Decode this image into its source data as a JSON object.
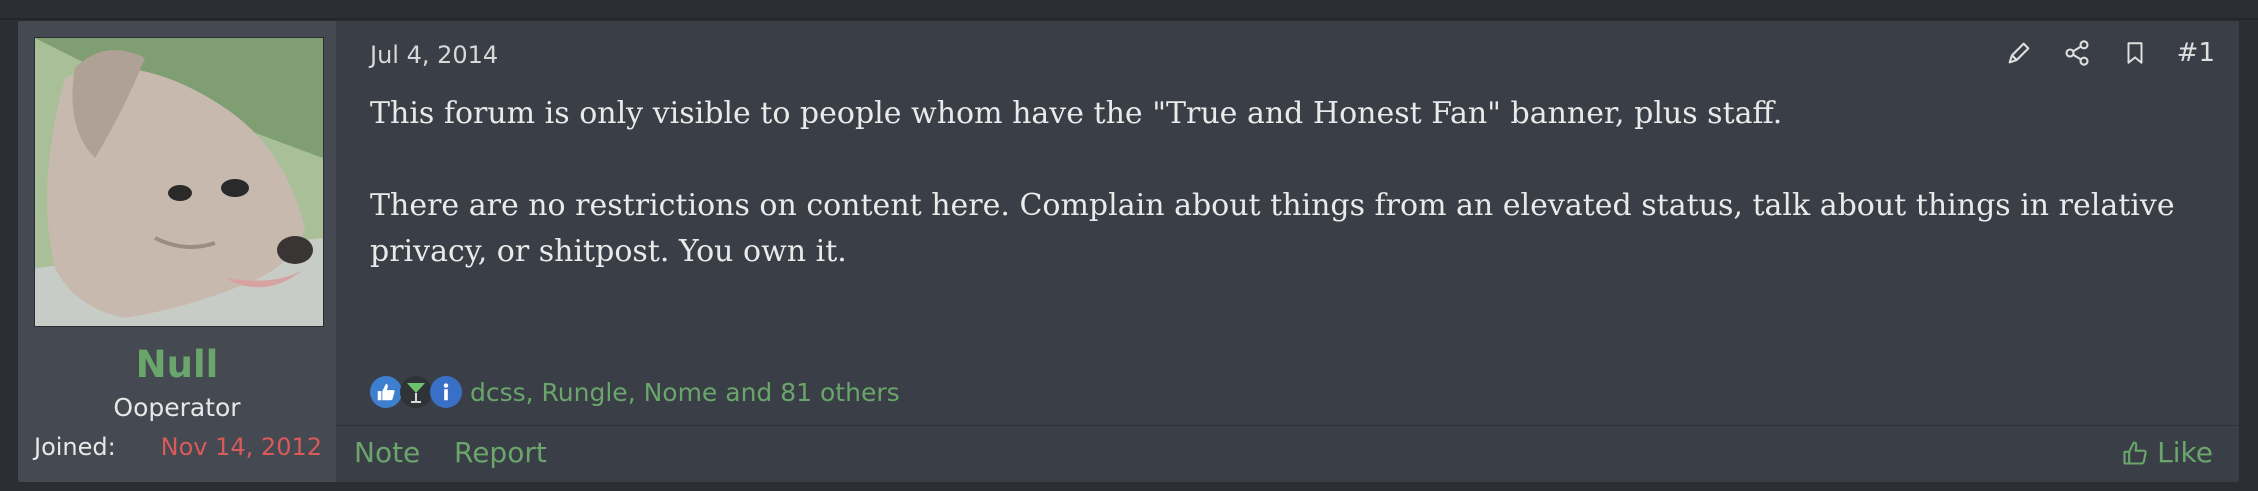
{
  "post": {
    "date": "Jul 4, 2014",
    "number": "#1",
    "message": [
      "This forum is only visible to people whom have the \"True and Honest Fan\" banner, plus staff.",
      "There are no restrictions on content here. Complain about things from an elevated status, talk about things in relative privacy, or shitpost. You own it."
    ],
    "reactions_text": "dcss, Rungle, Nome and 81 others"
  },
  "user": {
    "name": "Null",
    "title": "Ooperator",
    "joined_label": "Joined:",
    "joined_value": "Nov 14, 2012"
  },
  "actions": {
    "edit_icon": "pencil-icon",
    "share_icon": "share-icon",
    "bookmark_icon": "bookmark-icon"
  },
  "footer": {
    "note": "Note",
    "report": "Report",
    "like": "Like"
  },
  "colors": {
    "accent_green": "#6aa56b",
    "joined_red": "#d85a5a",
    "panel_bg": "#3a3e46"
  }
}
